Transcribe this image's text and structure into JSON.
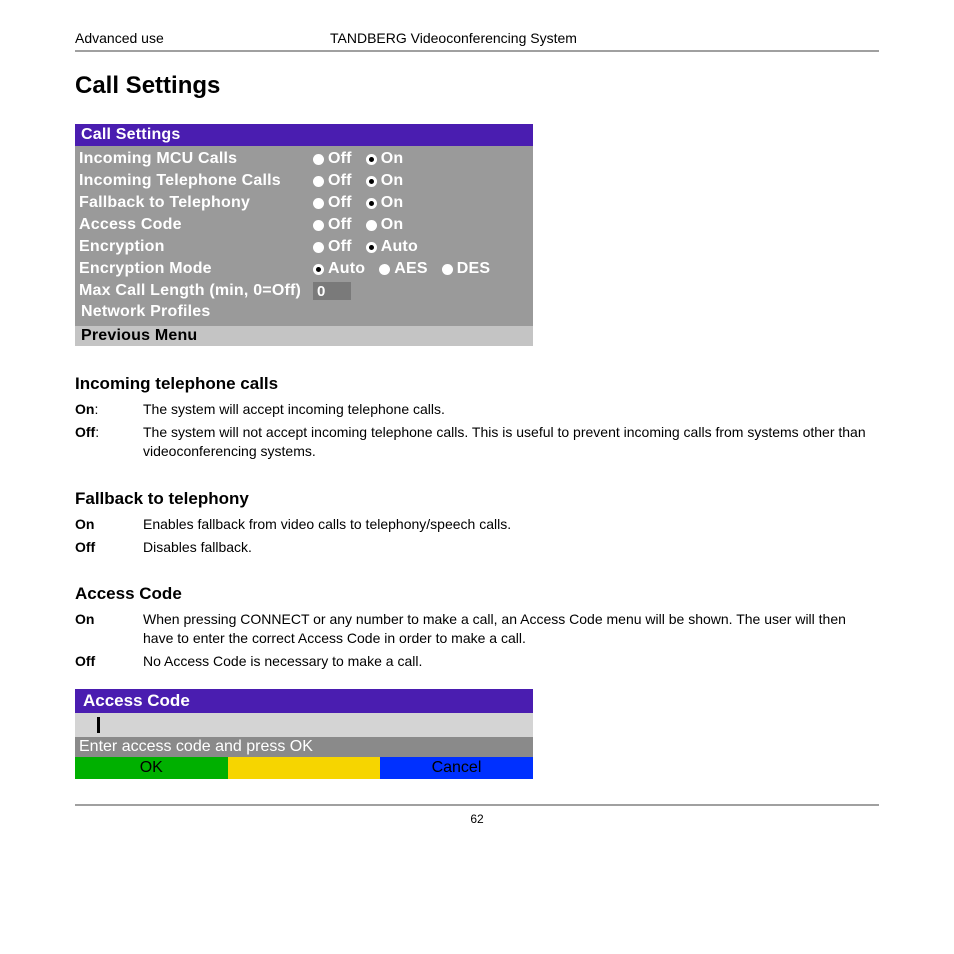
{
  "header": {
    "left": "Advanced use",
    "right": "TANDBERG Videoconferencing System"
  },
  "page_title": "Call Settings",
  "osd": {
    "title": "Call Settings",
    "rows": [
      {
        "label": "Incoming MCU Calls",
        "options": [
          "Off",
          "On"
        ],
        "selected": 1
      },
      {
        "label": "Incoming Telephone Calls",
        "options": [
          "Off",
          "On"
        ],
        "selected": 1
      },
      {
        "label": "Fallback to Telephony",
        "options": [
          "Off",
          "On"
        ],
        "selected": 1
      },
      {
        "label": "Access Code",
        "options": [
          "Off",
          "On"
        ],
        "selected": -1
      },
      {
        "label": "Encryption",
        "options": [
          "Off",
          "Auto"
        ],
        "selected": 1
      },
      {
        "label": "Encryption Mode",
        "options": [
          "Auto",
          "AES",
          "DES"
        ],
        "selected": 0
      }
    ],
    "max_call_label": "Max Call Length (min, 0=Off)",
    "max_call_value": "0",
    "network_profiles": "Network Profiles",
    "previous_menu": "Previous Menu"
  },
  "sections": [
    {
      "title": "Incoming telephone calls",
      "defs": [
        {
          "term": "On",
          "colon": ":",
          "desc": "The system will accept incoming telephone calls."
        },
        {
          "term": "Off",
          "colon": ":",
          "desc": "The system will not accept incoming telephone calls. This is useful to prevent incoming calls from systems other than videoconferencing systems."
        }
      ]
    },
    {
      "title": "Fallback to telephony",
      "defs": [
        {
          "term": "On",
          "colon": "",
          "desc": "Enables fallback from video calls to telephony/speech calls."
        },
        {
          "term": "Off",
          "colon": "",
          "desc": "Disables fallback."
        }
      ]
    },
    {
      "title": "Access Code",
      "defs": [
        {
          "term": "On",
          "colon": "",
          "desc": "When pressing CONNECT or any number to make a call, an Access Code menu will be shown. The user will then have to enter the correct Access Code in order to make a call."
        },
        {
          "term": "Off",
          "colon": "",
          "desc": "No Access Code is necessary to make a call."
        }
      ]
    }
  ],
  "access_dialog": {
    "title": "Access Code",
    "prompt": "Enter access code and press OK",
    "ok": "OK",
    "cancel": "Cancel"
  },
  "page_number": "62"
}
